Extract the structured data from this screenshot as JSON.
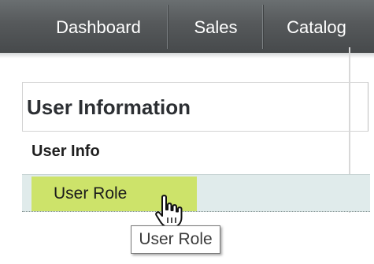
{
  "nav": {
    "items": [
      {
        "label": "Dashboard"
      },
      {
        "label": "Sales"
      },
      {
        "label": "Catalog"
      }
    ]
  },
  "panel": {
    "title": "User Information"
  },
  "tabs": {
    "user_info": "User Info",
    "user_role": "User Role"
  },
  "tooltip": {
    "text": "User Role"
  },
  "colors": {
    "nav_bg": "#56595b",
    "active_tab_highlight": "#cde36a",
    "tab_row_bg": "#e0ebeb"
  },
  "icons": {
    "cursor": "hand-pointer-icon"
  }
}
